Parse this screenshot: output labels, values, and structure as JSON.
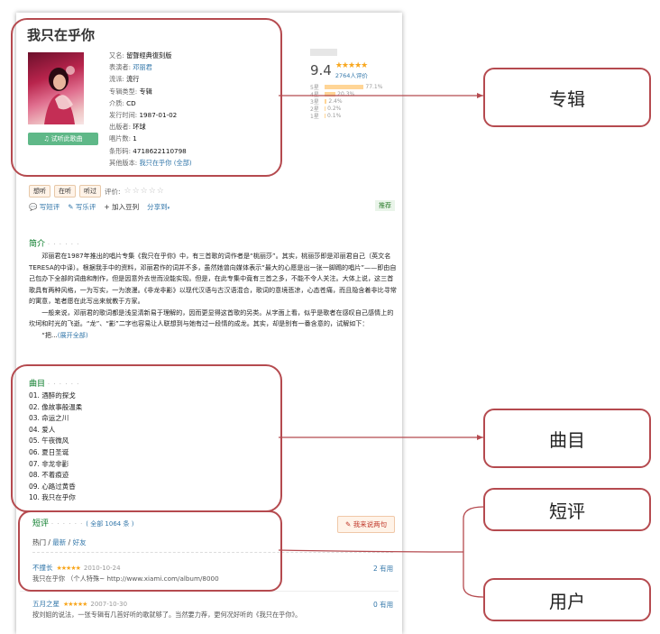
{
  "album": {
    "title": "我只在乎你",
    "listen_label": "试听此歌曲",
    "meta": [
      {
        "label": "又名:",
        "value": "留聲經典復刻版",
        "link": false
      },
      {
        "label": "表演者:",
        "value": "邓丽君",
        "link": true
      },
      {
        "label": "流派:",
        "value": "流行",
        "link": false
      },
      {
        "label": "专辑类型:",
        "value": "专辑",
        "link": false
      },
      {
        "label": "介质:",
        "value": "CD",
        "link": false
      },
      {
        "label": "发行时间:",
        "value": "1987-01-02",
        "link": false
      },
      {
        "label": "出版者:",
        "value": "环球",
        "link": false
      },
      {
        "label": "唱片数:",
        "value": "1",
        "link": false
      },
      {
        "label": "条形码:",
        "value": "4718622110798",
        "link": false
      }
    ],
    "other_version_label": "其他版本:",
    "other_version_value": "我只在乎你",
    "other_version_all": "(全部)"
  },
  "rating": {
    "score": "9.4",
    "stars": "★★★★★",
    "count": "2764人评价",
    "rows": [
      {
        "label": "5星",
        "pct": 77.1,
        "text": "77.1%"
      },
      {
        "label": "4星",
        "pct": 20.3,
        "text": "20.3%"
      },
      {
        "label": "3星",
        "pct": 2.4,
        "text": "2.4%"
      },
      {
        "label": "2星",
        "pct": 0.2,
        "text": "0.2%"
      },
      {
        "label": "1星",
        "pct": 0.1,
        "text": "0.1%"
      }
    ]
  },
  "interest": {
    "want": "想听",
    "doing": "在听",
    "done": "听过",
    "rate_label": "评价:",
    "rate_stars": "☆☆☆☆☆"
  },
  "actions": {
    "write_comment": "写短评",
    "write_review": "写乐评",
    "add_doulist": "加入豆列",
    "share": "分享到",
    "recommend": "推荐"
  },
  "intro": {
    "heading": "简介",
    "dots": "· · · · · ·",
    "p1": "邓丽君在1987年推出的唱片专集《我只在乎你》中，有三首歌的词作者是“桃丽莎”。其实，桃丽莎即是邓丽君自己（英文名TERESA的中译）。根据我手中的资料，邓丽君作的词并不多，虽然她曾向媒体表示“最大的心愿是出一张一脚踢的唱片”——即由自己包办下全部的词曲和制作，但是因意外去世而没能实现。但是，在此专集中竟有三首之多，不能不令人关注。大体上说，这三首歌具有两种风格，一为写实，一为浪漫。《非龙非彲》以现代汉语与古汉语混合，歌词的意境悲凉，心态苍痛，而且隐含着非比寻常的寓意，笔者愿在此写出来就教于方家。",
    "p2": "一般来说，邓丽君的歌词都是浅显清新易于理解的，因而更显得这首歌的另类。从字面上看，似乎是歌者在感叹自己感情上的坎坷和时光的飞逝。“龙”、“彲”二字也容易让人联想到与她有过一段情的成龙。其实，却是别有一番含意的，试解如下：",
    "p3": "“把...",
    "expand": "(展开全部)"
  },
  "tracks": {
    "heading": "曲目",
    "dots": "· · · · · ·",
    "items": [
      "01. 酒醉的探戈",
      "02. 像故事般温柔",
      "03. 命运之川",
      "04. 爱人",
      "05. 午夜微风",
      "06. 夏日圣诞",
      "07. 非龙非彲",
      "08. 不着痕迹",
      "09. 心路过黄昏",
      "10. 我只在乎你"
    ]
  },
  "comments": {
    "heading": "短评",
    "dots": "· · · · · ·",
    "total": "( 全部 1064 条 )",
    "write": "我来说两句",
    "sort_hot": "热门",
    "sort_new": "最新",
    "sort_friends": "好友",
    "items": [
      {
        "user": "不撞长",
        "stars": "★★★★★",
        "date": "2010-10-24",
        "text": "我只在乎你 （个人特殊~ http://www.xiami.com/album/8000",
        "useful": "2 有用"
      },
      {
        "user": "五月之星",
        "stars": "★★★★★",
        "date": "2007-10-30",
        "text": "按刘姐的说法，一张专辑有几首好听的歌就够了。当然要力荐，更何况好听的《我只在乎你》。",
        "useful": "0 有用"
      }
    ]
  },
  "callouts": {
    "album": "专辑",
    "tracks": "曲目",
    "comments": "短评",
    "users": "用户"
  },
  "colors": {
    "annotation": "#b54a4f",
    "link": "#37a",
    "green": "#007722",
    "star": "#f8a71e"
  }
}
